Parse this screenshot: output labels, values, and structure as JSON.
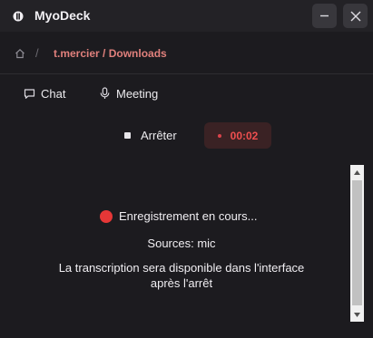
{
  "titlebar": {
    "app_name": "MyoDeck",
    "logo_icon": "app-logo-icon",
    "minimize_icon": "minimize-icon",
    "close_icon": "close-icon"
  },
  "breadcrumb": {
    "home_icon": "home-icon",
    "separator": "/",
    "path": "t.mercier / Downloads"
  },
  "tabs": [
    {
      "label": "Chat",
      "icon": "chat-bubble-icon"
    },
    {
      "label": "Meeting",
      "icon": "microphone-icon"
    }
  ],
  "controls": {
    "stop_label": "Arrêter",
    "timer": "00:02"
  },
  "status": {
    "recording_text": "Enregistrement en cours...",
    "sources": "Sources: mic",
    "info_line1": "La transcription sera disponible dans l'interface",
    "info_line2": "après l'arrêt"
  },
  "colors": {
    "accent": "#e0807c",
    "recording": "#e63737",
    "timer_text": "#ef4f4f"
  }
}
